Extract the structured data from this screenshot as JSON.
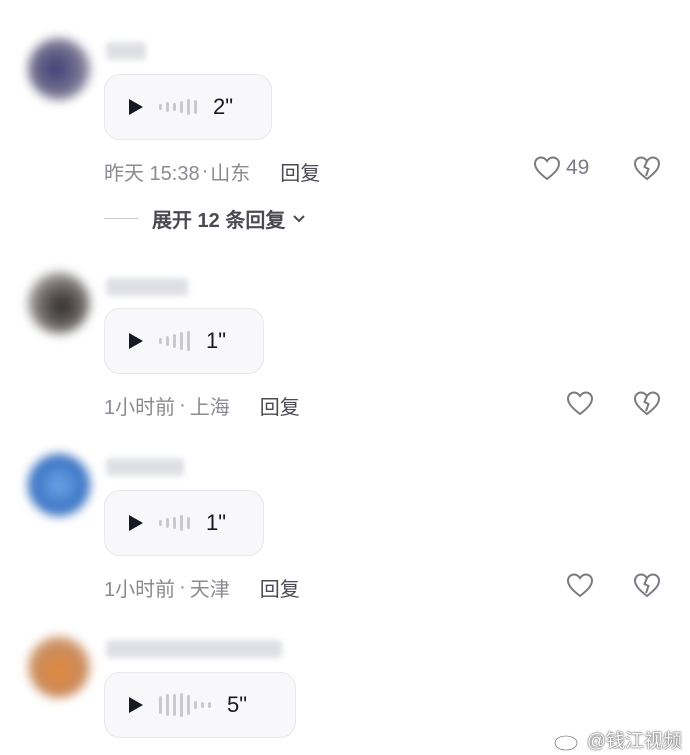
{
  "comments": [
    {
      "avatar_color": "#6d6a8a",
      "duration": "2\"",
      "time": "昨天 15:38",
      "location": "山东",
      "reply_label": "回复",
      "likes": "49",
      "expand_label": "展开 12 条回复"
    },
    {
      "avatar_color": "#7a7270",
      "duration": "1\"",
      "time": "1小时前",
      "location": "上海",
      "reply_label": "回复",
      "likes": ""
    },
    {
      "avatar_color": "#3f78c8",
      "duration": "1\"",
      "time": "1小时前",
      "location": "天津",
      "reply_label": "回复",
      "likes": ""
    },
    {
      "avatar_color": "#d98a4a",
      "duration": "5\"",
      "time": "",
      "location": "",
      "reply_label": "",
      "likes": ""
    }
  ],
  "separator": "·",
  "watermark": {
    "icon": "weibo-icon",
    "text": "@钱江视频"
  }
}
